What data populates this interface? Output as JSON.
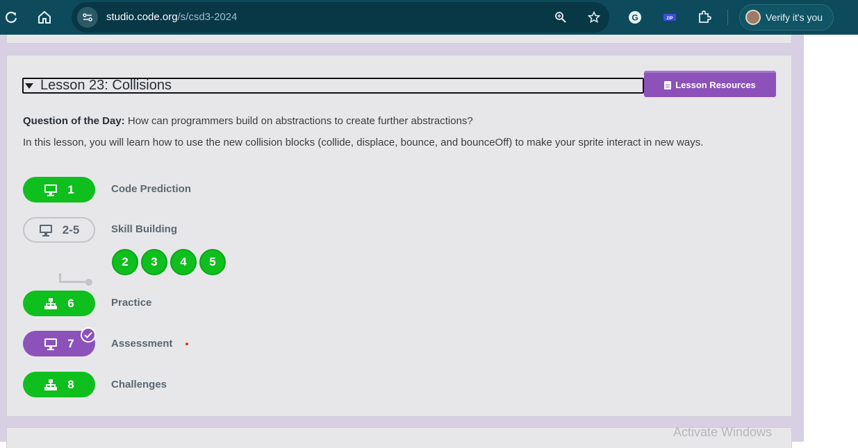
{
  "browser": {
    "url_host": "studio.code.org",
    "url_path": "/s/csd3-2024",
    "profile_label": "Verify it's you",
    "icons": [
      "reload-icon",
      "home-icon",
      "site-settings-icon",
      "zoom-icon",
      "star-icon",
      "grammarly-icon",
      "zip-extension-icon",
      "extensions-icon"
    ]
  },
  "lesson": {
    "title": "Lesson 23: Collisions",
    "resources_label": "Lesson Resources",
    "qotd_label": "Question of the Day:",
    "qotd_text": " How can programmers build on abstractions to create further abstractions?",
    "description": "In this lesson, you will learn how to use the new collision blocks (collide, displace, bounce, and bounceOff) to make your sprite interact in new ways."
  },
  "levels": [
    {
      "number": "1",
      "label": "Code Prediction",
      "icon": "monitor-icon",
      "state": "completed"
    },
    {
      "number": "2-5",
      "label": "Skill Building",
      "icon": "monitor-icon",
      "state": "outline"
    },
    {
      "number": "6",
      "label": "Practice",
      "icon": "hierarchy-icon",
      "state": "completed"
    },
    {
      "number": "7",
      "label": "Assessment",
      "icon": "monitor-icon",
      "state": "submitted"
    },
    {
      "number": "8",
      "label": "Challenges",
      "icon": "hierarchy-icon",
      "state": "completed"
    }
  ],
  "sublevels": [
    "2",
    "3",
    "4",
    "5"
  ],
  "colors": {
    "completed": "#0fbf1d",
    "assessment": "#8c52ba",
    "toolbar": "#0d4a5c",
    "page_bg": "#d6d0e2"
  },
  "watermark": "Activate Windows"
}
